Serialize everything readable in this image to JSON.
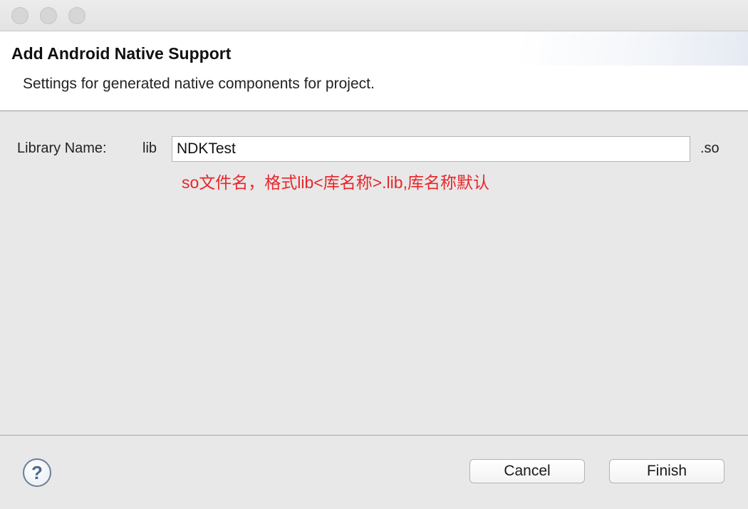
{
  "window": {
    "controls": [
      "close",
      "minimize",
      "maximize"
    ]
  },
  "header": {
    "title": "Add Android Native Support",
    "description": "Settings for generated native components for project."
  },
  "form": {
    "library_name_label": "Library Name:",
    "prefix": "lib",
    "library_name_value": "NDKTest",
    "suffix": ".so",
    "annotation": "so文件名，格式lib<库名称>.lib,库名称默认",
    "annotation_color": "#e8262b"
  },
  "footer": {
    "help_glyph": "?",
    "help_icon": "question-circle-icon",
    "cancel_label": "Cancel",
    "finish_label": "Finish"
  }
}
